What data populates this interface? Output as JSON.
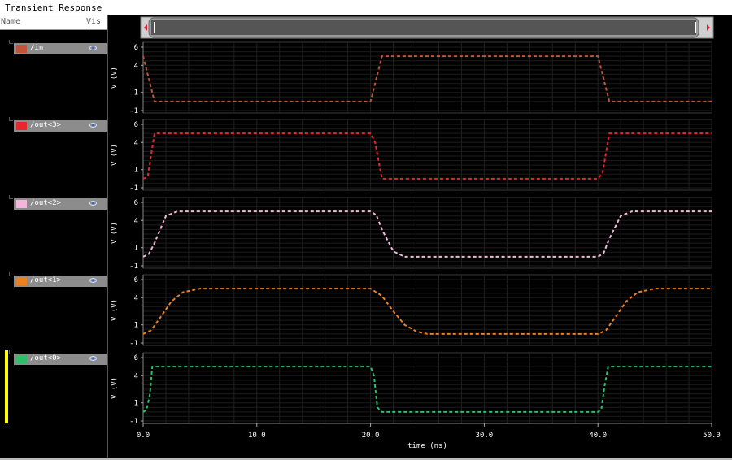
{
  "window": {
    "title": "Transient Response"
  },
  "header": {
    "name_label": "Name",
    "vis_label": "Vis"
  },
  "signals": [
    {
      "name": "/in",
      "color": "#c0553a"
    },
    {
      "name": "/out<3>",
      "color": "#e8262d"
    },
    {
      "name": "/out<2>",
      "color": "#f3b6d8"
    },
    {
      "name": "/out<1>",
      "color": "#ef7f1a"
    },
    {
      "name": "/out<0>",
      "color": "#2bc06a"
    }
  ],
  "y_axis": {
    "label": "V (V)",
    "ticks": [
      "6",
      "4",
      "1",
      "-1"
    ],
    "tick_values": [
      6,
      4,
      1,
      -1
    ]
  },
  "x_axis": {
    "label": "time (ns)",
    "ticks": [
      "0.0",
      "10.0",
      "20.0",
      "30.0",
      "40.0",
      "50.0"
    ],
    "range": [
      0,
      50
    ]
  },
  "chart_data": {
    "type": "line",
    "x_label": "time (ns)",
    "y_label": "V (V)",
    "xlim": [
      0,
      50
    ],
    "ylim": [
      -1,
      6
    ],
    "grid": true,
    "series": [
      {
        "name": "/in",
        "points": [
          [
            0,
            5
          ],
          [
            1,
            0
          ],
          [
            20,
            0
          ],
          [
            21,
            5
          ],
          [
            40,
            5
          ],
          [
            41,
            0
          ],
          [
            50,
            0
          ]
        ]
      },
      {
        "name": "/out<3>",
        "points": [
          [
            0,
            0
          ],
          [
            0.4,
            0.2
          ],
          [
            1,
            5
          ],
          [
            20,
            5
          ],
          [
            20.4,
            4
          ],
          [
            21,
            0
          ],
          [
            40,
            0
          ],
          [
            40.4,
            0.6
          ],
          [
            41,
            5
          ],
          [
            50,
            5
          ]
        ]
      },
      {
        "name": "/out<2>",
        "points": [
          [
            0,
            0
          ],
          [
            0.5,
            0.3
          ],
          [
            1,
            1.5
          ],
          [
            2,
            4.5
          ],
          [
            3,
            5
          ],
          [
            20,
            5
          ],
          [
            20.5,
            4.6
          ],
          [
            21,
            3
          ],
          [
            22,
            0.6
          ],
          [
            23,
            0
          ],
          [
            40,
            0
          ],
          [
            40.5,
            0.4
          ],
          [
            41,
            2
          ],
          [
            42,
            4.5
          ],
          [
            43,
            5
          ],
          [
            50,
            5
          ]
        ]
      },
      {
        "name": "/out<1>",
        "points": [
          [
            0,
            0
          ],
          [
            0.7,
            0.4
          ],
          [
            1.5,
            1.8
          ],
          [
            2.5,
            3.6
          ],
          [
            3.5,
            4.6
          ],
          [
            5,
            5
          ],
          [
            20,
            5
          ],
          [
            21,
            4.2
          ],
          [
            22,
            2.5
          ],
          [
            23,
            1
          ],
          [
            24,
            0.3
          ],
          [
            25,
            0
          ],
          [
            40,
            0
          ],
          [
            40.7,
            0.4
          ],
          [
            41.5,
            1.8
          ],
          [
            42.5,
            3.6
          ],
          [
            43.5,
            4.6
          ],
          [
            45,
            5
          ],
          [
            50,
            5
          ]
        ]
      },
      {
        "name": "/out<0>",
        "points": [
          [
            0,
            0
          ],
          [
            0.3,
            0.2
          ],
          [
            0.6,
            2
          ],
          [
            0.8,
            5
          ],
          [
            20,
            5
          ],
          [
            20.3,
            4
          ],
          [
            20.6,
            0.5
          ],
          [
            21,
            0
          ],
          [
            40,
            0
          ],
          [
            40.3,
            0.3
          ],
          [
            40.6,
            3
          ],
          [
            40.9,
            5
          ],
          [
            50,
            5
          ]
        ]
      }
    ]
  }
}
